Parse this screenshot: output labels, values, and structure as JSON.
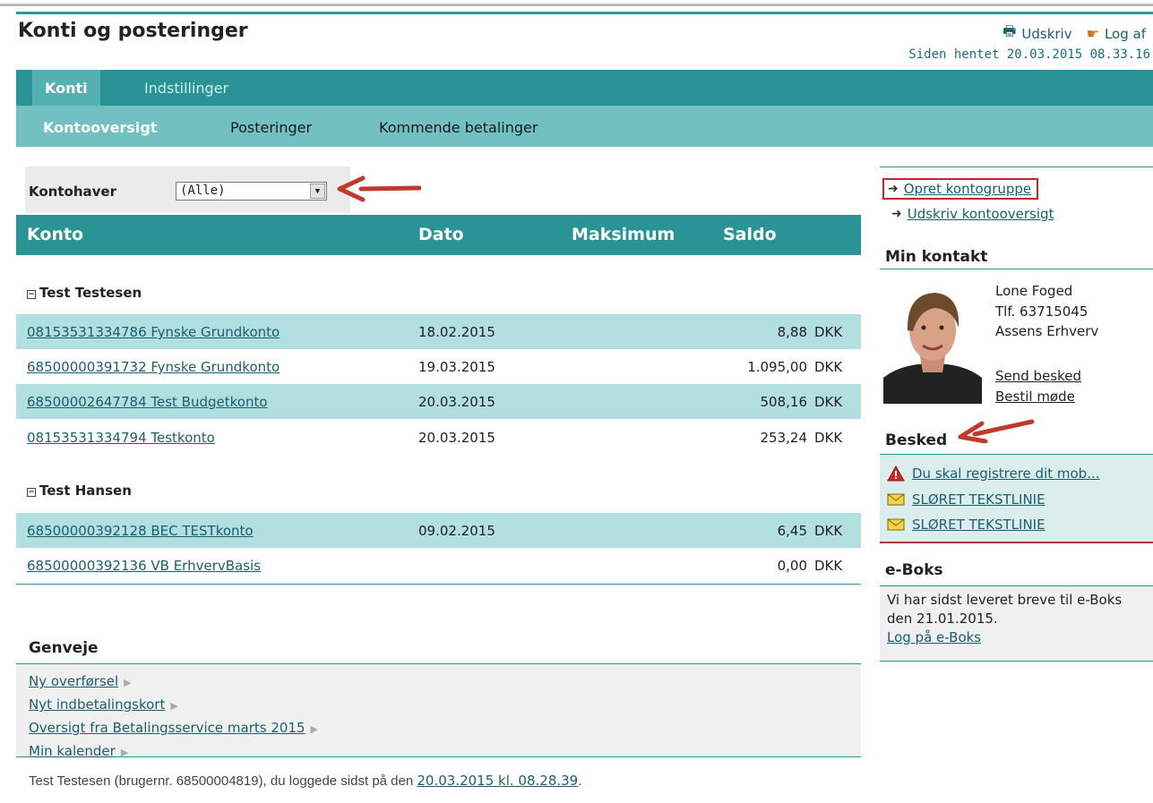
{
  "header": {
    "title": "Konti og posteringer",
    "print_label": "Udskriv",
    "logout_label": "Log af",
    "fetched_text": "Siden hentet 20.03.2015 08.33.16"
  },
  "nav": {
    "primary": [
      {
        "label": "Konti",
        "active": true
      },
      {
        "label": "Indstillinger",
        "active": false
      }
    ],
    "secondary": [
      {
        "label": "Kontooversigt",
        "active": true
      },
      {
        "label": "Posteringer",
        "active": false
      },
      {
        "label": "Kommende betalinger",
        "active": false
      }
    ]
  },
  "filter": {
    "label": "Kontohaver",
    "selected": "(Alle)"
  },
  "table": {
    "headers": {
      "account": "Konto",
      "date": "Dato",
      "max": "Maksimum",
      "balance": "Saldo"
    },
    "groups": [
      {
        "name": "Test Testesen",
        "rows": [
          {
            "account": "08153531334786 Fynske Grundkonto",
            "date": "18.02.2015",
            "balance": "8,88",
            "currency": "DKK"
          },
          {
            "account": "68500000391732 Fynske Grundkonto",
            "date": "19.03.2015",
            "balance": "1.095,00",
            "currency": "DKK"
          },
          {
            "account": "68500002647784 Test Budgetkonto",
            "date": "20.03.2015",
            "balance": "508,16",
            "currency": "DKK"
          },
          {
            "account": "08153531334794 Testkonto",
            "date": "20.03.2015",
            "balance": "253,24",
            "currency": "DKK"
          }
        ]
      },
      {
        "name": "Test Hansen",
        "rows": [
          {
            "account": "68500000392128 BEC TESTkonto",
            "date": "09.02.2015",
            "balance": "6,45",
            "currency": "DKK"
          },
          {
            "account": "68500000392136 VB ErhvervBasis",
            "date": "",
            "balance": "0,00",
            "currency": "DKK"
          }
        ]
      }
    ]
  },
  "shortcuts": {
    "title": "Genveje",
    "items": [
      "Ny overførsel",
      "Nyt indbetalingskort",
      "Oversigt fra Betalingsservice marts 2015",
      "Min kalender"
    ]
  },
  "footer": {
    "text": "Test Testesen (brugernr. 68500004819), du loggede sidst på den",
    "link": "20.03.2015 kl. 08.28.39",
    "end": "."
  },
  "sidebar": {
    "actions": [
      "Opret kontogruppe",
      "Udskriv kontooversigt"
    ],
    "contact": {
      "title": "Min kontakt",
      "name": "Lone Foged",
      "phone": "Tlf. 63715045",
      "branch": "Assens Erhverv",
      "send_message": "Send besked",
      "book_meeting": "Bestil møde"
    },
    "messages": {
      "title": "Besked",
      "items": [
        {
          "icon": "warning-icon",
          "text": "Du skal registrere dit mob..."
        },
        {
          "icon": "envelope-icon",
          "text": "SLØRET TEKSTLINIE"
        },
        {
          "icon": "envelope-icon",
          "text": "SLØRET TEKSTLINIE"
        }
      ]
    },
    "eboks": {
      "title": "e-Boks",
      "text": "Vi har sidst leveret breve til e-Boks den 21.01.2015.",
      "link": "Log på e-Boks"
    }
  },
  "colors": {
    "nav_primary": "#2a9395",
    "nav_secondary": "#72c0c2",
    "row_alt": "#b2dfdf",
    "link": "#1b5e6e",
    "annotation_red": "#c0262c"
  }
}
